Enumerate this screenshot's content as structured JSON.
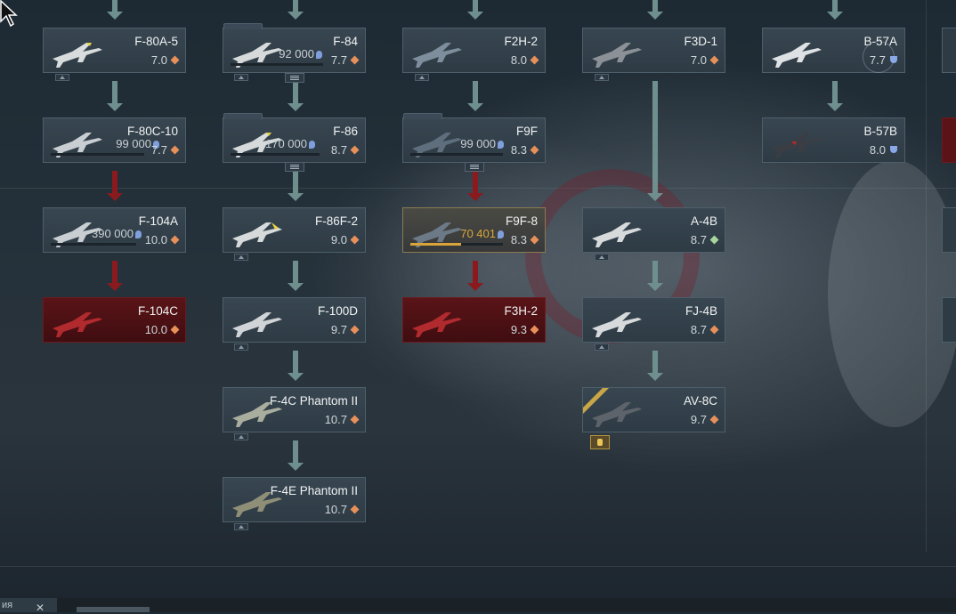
{
  "tree": {
    "vehicles": [
      {
        "id": "f80a5",
        "name": "F-80A-5",
        "br": "7.0",
        "mode": "air"
      },
      {
        "id": "f80c10",
        "name": "F-80C-10",
        "br": "7.7",
        "mode": "air",
        "rp": "99 000"
      },
      {
        "id": "f104a",
        "name": "F-104A",
        "br": "10.0",
        "mode": "air",
        "rp": "390 000"
      },
      {
        "id": "f104c",
        "name": "F-104C",
        "br": "10.0",
        "mode": "air"
      },
      {
        "id": "f84",
        "name": "F-84",
        "br": "7.7",
        "mode": "air",
        "rp": "92 000"
      },
      {
        "id": "f86",
        "name": "F-86",
        "br": "8.7",
        "mode": "air",
        "rp": "170 000"
      },
      {
        "id": "f86f2",
        "name": "F-86F-2",
        "br": "9.0",
        "mode": "air"
      },
      {
        "id": "f100d",
        "name": "F-100D",
        "br": "9.7",
        "mode": "air"
      },
      {
        "id": "f4c",
        "name": "F-4C Phantom II",
        "br": "10.7",
        "mode": "air"
      },
      {
        "id": "f4e",
        "name": "F-4E Phantom II",
        "br": "10.7",
        "mode": "air"
      },
      {
        "id": "f2h2",
        "name": "F2H-2",
        "br": "8.0",
        "mode": "air"
      },
      {
        "id": "f9f",
        "name": "F9F",
        "br": "8.3",
        "mode": "air",
        "rp": "99 000"
      },
      {
        "id": "f9f8",
        "name": "F9F-8",
        "br": "8.3",
        "mode": "air",
        "rp": "70 401"
      },
      {
        "id": "f3h2",
        "name": "F3H-2",
        "br": "9.3",
        "mode": "air"
      },
      {
        "id": "f3d1",
        "name": "F3D-1",
        "br": "7.0",
        "mode": "air"
      },
      {
        "id": "a4b",
        "name": "A-4B",
        "br": "8.7",
        "mode": "attacker"
      },
      {
        "id": "fj4b",
        "name": "FJ-4B",
        "br": "8.7",
        "mode": "air"
      },
      {
        "id": "av8c",
        "name": "AV-8C",
        "br": "9.7",
        "mode": "air"
      },
      {
        "id": "b57a",
        "name": "B-57A",
        "br": "7.7",
        "mode": "bomber"
      },
      {
        "id": "b57b",
        "name": "B-57B",
        "br": "8.0",
        "mode": "bomber"
      }
    ],
    "progress": {
      "f80c10": 0.0,
      "f104a": 0.0,
      "f84": 0.0,
      "f86": 0.0,
      "f9f": 0.0,
      "f9f8": 0.55
    }
  },
  "bottom": {
    "tab_label": "ия",
    "close_glyph": "✕"
  },
  "colors": {
    "arrow": "#6f8f8e",
    "locked": "#8a1a1e",
    "selected_rp": "#d9a53a",
    "rp_icon": "#7f9fdc"
  }
}
